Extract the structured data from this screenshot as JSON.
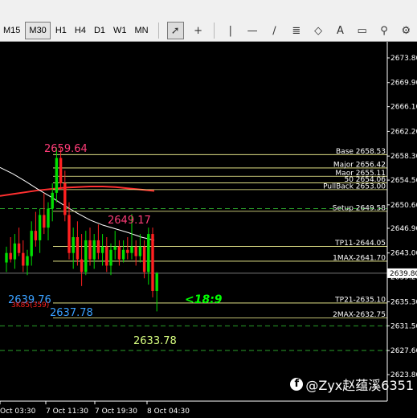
{
  "toolbar": {
    "timeframes": [
      "M15",
      "M30",
      "H1",
      "H4",
      "D1",
      "W1",
      "MN"
    ],
    "active_timeframe": "M30",
    "tools": [
      {
        "name": "cursor-icon",
        "glyph": "➚"
      },
      {
        "name": "crosshair-icon",
        "glyph": "+"
      },
      {
        "name": "vertical-line-icon",
        "glyph": "|"
      },
      {
        "name": "horizontal-line-icon",
        "glyph": "—"
      },
      {
        "name": "trendline-icon",
        "glyph": "∕"
      },
      {
        "name": "fibonacci-icon",
        "glyph": "≣"
      },
      {
        "name": "shapes-icon",
        "glyph": "◇"
      },
      {
        "name": "text-icon",
        "glyph": "A"
      },
      {
        "name": "text-label-icon",
        "glyph": "▭"
      },
      {
        "name": "search-icon",
        "glyph": "⚲"
      },
      {
        "name": "settings-icon",
        "glyph": "⚙"
      }
    ]
  },
  "colors": {
    "background": "#000000",
    "up": "#00e000",
    "down": "#ff2020",
    "level_line": "#ffff99",
    "ma_red": "#ff3030",
    "ma_white": "#ffffff",
    "label_pink": "#ff3c78",
    "label_blue": "#3aa0ff",
    "label_yellow_green": "#d8ff80",
    "countdown": "#00ff00"
  },
  "price_axis": {
    "ticks": [
      "2673.80",
      "2669.90",
      "2666.10",
      "2662.20",
      "2658.30",
      "2654.50",
      "2650.60",
      "2646.90",
      "2643.00",
      "2639.20",
      "2635.30",
      "2631.50",
      "2627.60",
      "2623.80"
    ],
    "current_price": "2639.80",
    "current_price_value": 2639.8
  },
  "time_axis": {
    "ticks": [
      "Oct 03:30",
      "7 Oct 11:30",
      "7 Oct 19:30",
      "8 Oct 04:30"
    ]
  },
  "levels": [
    {
      "label": "Base 2658.53",
      "price": 2658.53
    },
    {
      "label": "Major 2656.42",
      "price": 2656.42
    },
    {
      "label": "Maor 2655.11",
      "price": 2655.11
    },
    {
      "label": "50 2654.06",
      "price": 2654.06
    },
    {
      "label": "PullBack 2653.00",
      "price": 2653.0
    },
    {
      "label": "Setup 2649.58",
      "price": 2649.58
    },
    {
      "label": "TP11-2644.05",
      "price": 2644.05
    },
    {
      "label": "1MAX-2641.70",
      "price": 2641.7
    },
    {
      "label": "TP21-2635.10",
      "price": 2635.1
    },
    {
      "label": "2MAX-2632.75",
      "price": 2632.75
    }
  ],
  "annotations": [
    {
      "text": "2659.64",
      "color": "pink"
    },
    {
      "text": "2649.17",
      "color": "pink"
    },
    {
      "text": "2639.76",
      "color": "blue"
    },
    {
      "text": "2637.78",
      "color": "blue"
    },
    {
      "text": "2633.78",
      "color": "yellow_green"
    },
    {
      "text": "3K85(359)",
      "color": "red"
    }
  ],
  "countdown": "<18:9",
  "watermark": "@Zyx赵蕴溪6351",
  "chart_data": {
    "type": "candlestick",
    "candles": [
      {
        "o": 2641.5,
        "h": 2644.0,
        "l": 2640.0,
        "c": 2643.0
      },
      {
        "o": 2643.0,
        "h": 2645.5,
        "l": 2641.5,
        "c": 2642.0
      },
      {
        "o": 2642.0,
        "h": 2646.0,
        "l": 2640.5,
        "c": 2644.5
      },
      {
        "o": 2644.5,
        "h": 2647.0,
        "l": 2642.5,
        "c": 2643.0
      },
      {
        "o": 2643.0,
        "h": 2645.0,
        "l": 2640.0,
        "c": 2641.0
      },
      {
        "o": 2641.0,
        "h": 2643.5,
        "l": 2639.5,
        "c": 2642.5
      },
      {
        "o": 2642.5,
        "h": 2648.0,
        "l": 2641.0,
        "c": 2646.5
      },
      {
        "o": 2646.5,
        "h": 2649.5,
        "l": 2644.0,
        "c": 2645.0
      },
      {
        "o": 2645.0,
        "h": 2650.0,
        "l": 2643.0,
        "c": 2649.0
      },
      {
        "o": 2649.0,
        "h": 2652.5,
        "l": 2646.0,
        "c": 2647.0
      },
      {
        "o": 2647.0,
        "h": 2651.0,
        "l": 2645.0,
        "c": 2650.0
      },
      {
        "o": 2650.0,
        "h": 2654.0,
        "l": 2648.0,
        "c": 2652.5
      },
      {
        "o": 2652.5,
        "h": 2659.64,
        "l": 2651.0,
        "c": 2658.0
      },
      {
        "o": 2658.0,
        "h": 2659.6,
        "l": 2653.0,
        "c": 2654.0
      },
      {
        "o": 2654.0,
        "h": 2656.0,
        "l": 2648.0,
        "c": 2649.0
      },
      {
        "o": 2649.0,
        "h": 2651.0,
        "l": 2642.0,
        "c": 2643.0
      },
      {
        "o": 2643.0,
        "h": 2647.0,
        "l": 2640.5,
        "c": 2645.5
      },
      {
        "o": 2645.5,
        "h": 2648.0,
        "l": 2641.0,
        "c": 2642.0
      },
      {
        "o": 2642.0,
        "h": 2646.0,
        "l": 2637.78,
        "c": 2640.0
      },
      {
        "o": 2640.0,
        "h": 2646.5,
        "l": 2639.5,
        "c": 2645.0
      },
      {
        "o": 2645.0,
        "h": 2647.0,
        "l": 2641.0,
        "c": 2642.0
      },
      {
        "o": 2642.0,
        "h": 2646.0,
        "l": 2640.5,
        "c": 2645.0
      },
      {
        "o": 2645.0,
        "h": 2647.5,
        "l": 2642.0,
        "c": 2643.0
      },
      {
        "o": 2643.0,
        "h": 2646.0,
        "l": 2641.0,
        "c": 2644.0
      },
      {
        "o": 2644.0,
        "h": 2645.5,
        "l": 2640.0,
        "c": 2641.0
      },
      {
        "o": 2641.0,
        "h": 2644.5,
        "l": 2639.5,
        "c": 2643.5
      },
      {
        "o": 2643.5,
        "h": 2646.5,
        "l": 2642.0,
        "c": 2644.0
      },
      {
        "o": 2644.0,
        "h": 2645.0,
        "l": 2641.0,
        "c": 2642.0
      },
      {
        "o": 2642.0,
        "h": 2645.0,
        "l": 2641.5,
        "c": 2643.5
      },
      {
        "o": 2643.5,
        "h": 2645.5,
        "l": 2642.0,
        "c": 2643.0
      },
      {
        "o": 2643.0,
        "h": 2649.17,
        "l": 2642.0,
        "c": 2644.0
      },
      {
        "o": 2644.0,
        "h": 2645.0,
        "l": 2641.0,
        "c": 2642.5
      },
      {
        "o": 2642.5,
        "h": 2646.0,
        "l": 2641.5,
        "c": 2644.0
      },
      {
        "o": 2644.0,
        "h": 2645.0,
        "l": 2639.0,
        "c": 2640.0
      },
      {
        "o": 2640.0,
        "h": 2647.0,
        "l": 2638.0,
        "c": 2646.0
      },
      {
        "o": 2646.0,
        "h": 2647.0,
        "l": 2636.0,
        "c": 2637.0
      },
      {
        "o": 2637.0,
        "h": 2640.0,
        "l": 2633.78,
        "c": 2639.8
      }
    ],
    "ma_red": [
      2652.0,
      2652.3,
      2652.6,
      2652.9,
      2653.1,
      2653.3,
      2653.4,
      2653.5,
      2653.5,
      2653.4,
      2653.2,
      2653.0,
      2652.8
    ],
    "ma_white": [
      2656.5,
      2655.5,
      2654.3,
      2653.0,
      2651.8,
      2650.5,
      2649.3,
      2648.2,
      2647.4,
      2646.8,
      2646.2,
      2645.5,
      2645.0
    ]
  }
}
